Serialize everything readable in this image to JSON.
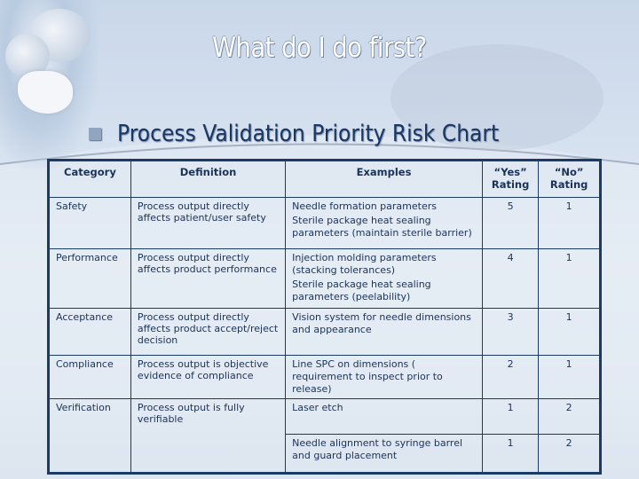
{
  "slide": {
    "title": "What do I do first?",
    "subtitle": "Process Validation Priority Risk Chart"
  },
  "table": {
    "headers": {
      "category": "Category",
      "definition": "Definition",
      "examples": "Examples",
      "yes_line1": "“Yes”",
      "yes_line2": "Rating",
      "no_line1": "“No”",
      "no_line2": "Rating"
    },
    "rows": [
      {
        "category": "Safety",
        "definition": "Process output directly affects patient/user safety",
        "examples": [
          "Needle formation parameters",
          "Sterile package heat sealing parameters (maintain sterile barrier)"
        ],
        "yes": "5",
        "no": "1"
      },
      {
        "category": "Performance",
        "definition": "Process output directly affects product performance",
        "examples": [
          "Injection molding parameters (stacking tolerances)",
          "Sterile package heat sealing parameters (peelability)"
        ],
        "yes": "4",
        "no": "1"
      },
      {
        "category": "Acceptance",
        "definition": "Process output directly affects product accept/reject decision",
        "examples": [
          "Vision system for needle dimensions and appearance"
        ],
        "yes": "3",
        "no": "1"
      },
      {
        "category": "Compliance",
        "definition": "Process output is objective evidence of compliance",
        "examples": [
          "Line SPC on dimensions ( requirement to inspect prior to release)"
        ],
        "yes": "2",
        "no": "1"
      },
      {
        "category": "Verification",
        "definition": "Process output is fully verifiable",
        "examples": [
          "Laser etch"
        ],
        "yes": "1",
        "no": "2"
      },
      {
        "examples": [
          "Needle alignment to syringe barrel and guard placement"
        ],
        "yes": "1",
        "no": "2"
      }
    ]
  }
}
